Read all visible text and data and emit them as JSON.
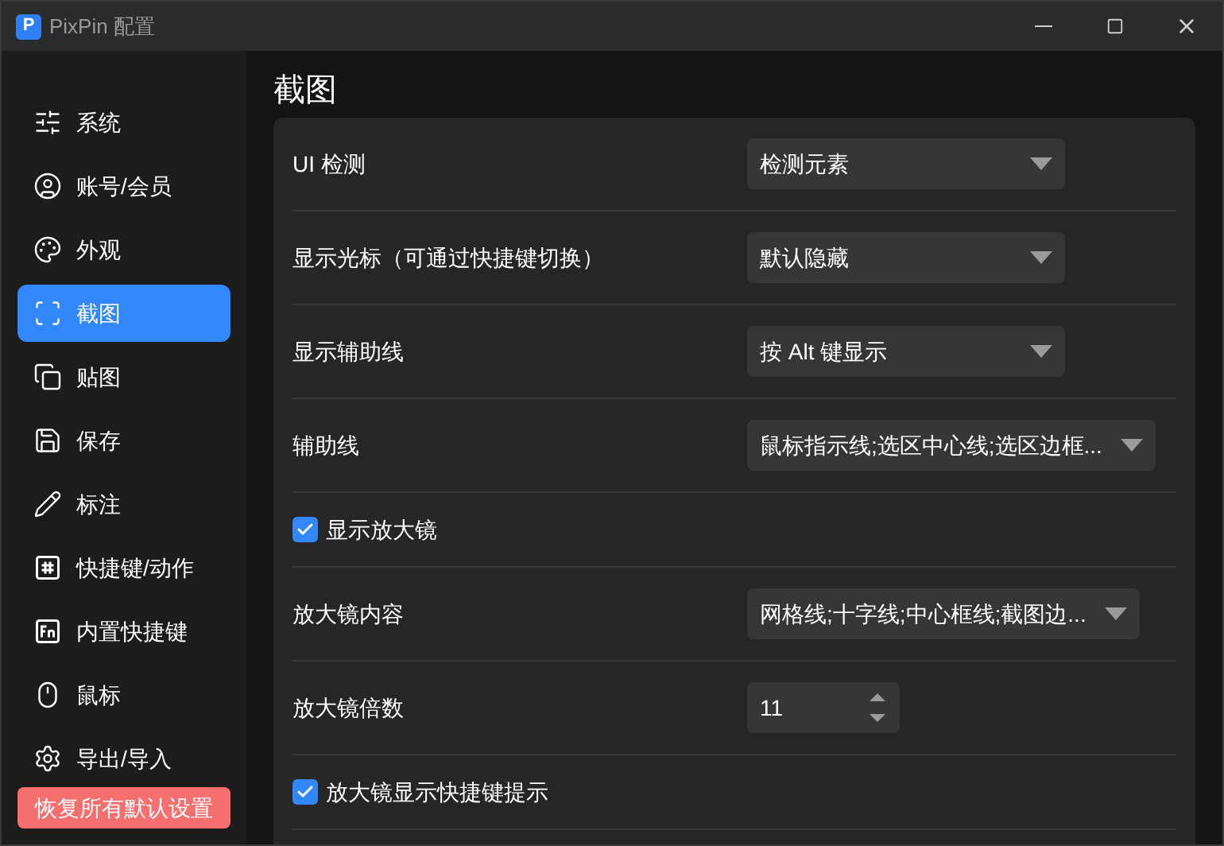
{
  "window": {
    "logo": "P",
    "title": "PixPin 配置"
  },
  "sidebar": {
    "items": [
      {
        "label": "系统",
        "selected": false
      },
      {
        "label": "账号/会员",
        "selected": false
      },
      {
        "label": "外观",
        "selected": false
      },
      {
        "label": "截图",
        "selected": true
      },
      {
        "label": "贴图",
        "selected": false
      },
      {
        "label": "保存",
        "selected": false
      },
      {
        "label": "标注",
        "selected": false
      },
      {
        "label": "快捷键/动作",
        "selected": false
      },
      {
        "label": "内置快捷键",
        "selected": false
      },
      {
        "label": "鼠标",
        "selected": false
      },
      {
        "label": "导出/导入",
        "selected": false
      }
    ],
    "reset_button": "恢复所有默认设置"
  },
  "page": {
    "title": "截图",
    "settings": [
      {
        "kind": "select",
        "label": "UI 检测",
        "value": "检测元素"
      },
      {
        "kind": "select",
        "label": "显示光标（可通过快捷键切换）",
        "value": "默认隐藏"
      },
      {
        "kind": "select",
        "label": "显示辅助线",
        "value": "按 Alt 键显示"
      },
      {
        "kind": "select",
        "label": "辅助线",
        "value": "鼠标指示线;选区中心线;选区边框..."
      },
      {
        "kind": "checkbox",
        "label": "显示放大镜",
        "checked": true
      },
      {
        "kind": "select",
        "label": "放大镜内容",
        "value": "网格线;十字线;中心框线;截图边..."
      },
      {
        "kind": "number",
        "label": "放大镜倍数",
        "value": "11"
      },
      {
        "kind": "checkbox",
        "label": "放大镜显示快捷键提示",
        "checked": true
      }
    ]
  }
}
